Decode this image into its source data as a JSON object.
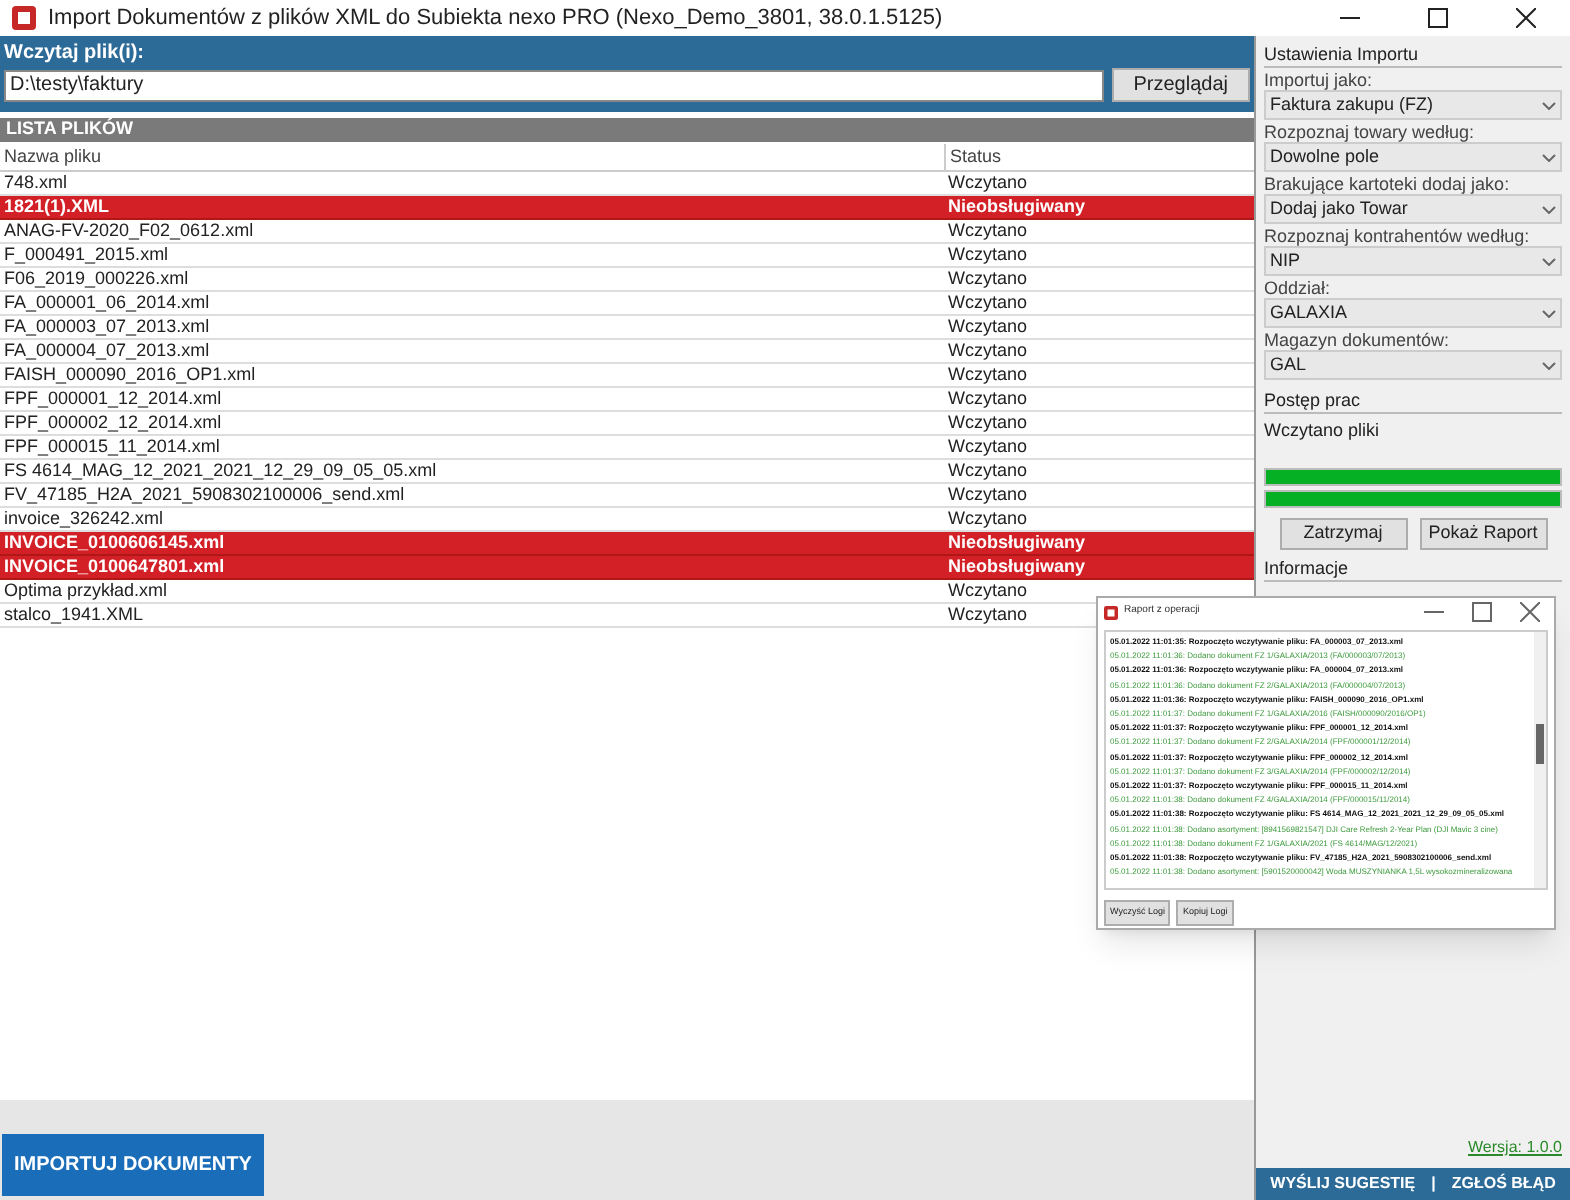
{
  "window": {
    "title": "Import Dokumentów z plików XML do Subiekta nexo PRO (Nexo_Demo_3801, 38.0.1.5125)"
  },
  "load": {
    "label": "Wczytaj plik(i):",
    "value": "D:\\testy\\faktury",
    "browse": "Przeglądaj"
  },
  "file_list": {
    "title": "LISTA PLIKÓW",
    "columns": [
      "Nazwa pliku",
      "Status"
    ],
    "rows": [
      {
        "name": "748.xml",
        "status": "Wczytano",
        "unsupported": false
      },
      {
        "name": "1821(1).XML",
        "status": "Nieobsługiwany",
        "unsupported": true
      },
      {
        "name": "ANAG-FV-2020_F02_0612.xml",
        "status": "Wczytano",
        "unsupported": false
      },
      {
        "name": "F_000491_2015.xml",
        "status": "Wczytano",
        "unsupported": false
      },
      {
        "name": "F06_2019_000226.xml",
        "status": "Wczytano",
        "unsupported": false
      },
      {
        "name": "FA_000001_06_2014.xml",
        "status": "Wczytano",
        "unsupported": false
      },
      {
        "name": "FA_000003_07_2013.xml",
        "status": "Wczytano",
        "unsupported": false
      },
      {
        "name": "FA_000004_07_2013.xml",
        "status": "Wczytano",
        "unsupported": false
      },
      {
        "name": "FAISH_000090_2016_OP1.xml",
        "status": "Wczytano",
        "unsupported": false
      },
      {
        "name": "FPF_000001_12_2014.xml",
        "status": "Wczytano",
        "unsupported": false
      },
      {
        "name": "FPF_000002_12_2014.xml",
        "status": "Wczytano",
        "unsupported": false
      },
      {
        "name": "FPF_000015_11_2014.xml",
        "status": "Wczytano",
        "unsupported": false
      },
      {
        "name": "FS 4614_MAG_12_2021_2021_12_29_09_05_05.xml",
        "status": "Wczytano",
        "unsupported": false
      },
      {
        "name": "FV_47185_H2A_2021_5908302100006_send.xml",
        "status": "Wczytano",
        "unsupported": false
      },
      {
        "name": "invoice_326242.xml",
        "status": "Wczytano",
        "unsupported": false
      },
      {
        "name": "INVOICE_0100606145.xml",
        "status": "Nieobsługiwany",
        "unsupported": true
      },
      {
        "name": "INVOICE_0100647801.xml",
        "status": "Nieobsługiwany",
        "unsupported": true
      },
      {
        "name": "Optima przykład.xml",
        "status": "Wczytano",
        "unsupported": false
      },
      {
        "name": "stalco_1941.XML",
        "status": "Wczytano",
        "unsupported": false
      }
    ]
  },
  "import_button": "IMPORTUJ DOKUMENTY",
  "settings": {
    "title": "Ustawienia Importu",
    "fields": [
      {
        "label": "Importuj jako:",
        "value": "Faktura zakupu (FZ)"
      },
      {
        "label": "Rozpoznaj towary według:",
        "value": "Dowolne pole"
      },
      {
        "label": "Brakujące kartoteki dodaj jako:",
        "value": "Dodaj jako Towar"
      },
      {
        "label": "Rozpoznaj kontrahentów według:",
        "value": "NIP"
      },
      {
        "label": "Oddział:",
        "value": "GALAXIA"
      },
      {
        "label": "Magazyn dokumentów:",
        "value": "GAL"
      }
    ]
  },
  "progress": {
    "title": "Postęp prac",
    "status": "Wczytano pliki",
    "bars": [
      {
        "level": 1
      },
      {
        "level": 1
      }
    ],
    "buttons": [
      "Zatrzymaj",
      "Pokaż Raport"
    ]
  },
  "info": {
    "title": "Informacje",
    "version": "Wersja: 1.0.0"
  },
  "footer": {
    "links": [
      "WYŚLIJ SUGESTIĘ",
      "|",
      "ZGŁOŚ BŁĄD"
    ]
  },
  "report": {
    "title": "Raport z operacji",
    "lines": [
      {
        "kind": "start",
        "text": "05.01.2022 11:01:35: Rozpoczęto wczytywanie pliku: FA_000003_07_2013.xml"
      },
      {
        "kind": "added",
        "text": "05.01.2022 11:01:36: Dodano dokument FZ 1/GALAXIA/2013 (FA/000003/07/2013)"
      },
      {
        "kind": "start",
        "text": "05.01.2022 11:01:36: Rozpoczęto wczytywanie pliku: FA_000004_07_2013.xml"
      },
      {
        "kind": "added",
        "text": "05.01.2022 11:01:36: Dodano dokument FZ 2/GALAXIA/2013 (FA/000004/07/2013)"
      },
      {
        "kind": "start",
        "text": "05.01.2022 11:01:36: Rozpoczęto wczytywanie pliku: FAISH_000090_2016_OP1.xml"
      },
      {
        "kind": "added",
        "text": "05.01.2022 11:01:37: Dodano dokument FZ 1/GALAXIA/2016 (FAISH/000090/2016/OP1)"
      },
      {
        "kind": "start",
        "text": "05.01.2022 11:01:37: Rozpoczęto wczytywanie pliku: FPF_000001_12_2014.xml"
      },
      {
        "kind": "added",
        "text": "05.01.2022 11:01:37: Dodano dokument FZ 2/GALAXIA/2014 (FPF/000001/12/2014)"
      },
      {
        "kind": "start",
        "text": "05.01.2022 11:01:37: Rozpoczęto wczytywanie pliku: FPF_000002_12_2014.xml"
      },
      {
        "kind": "added",
        "text": "05.01.2022 11:01:37: Dodano dokument FZ 3/GALAXIA/2014 (FPF/000002/12/2014)"
      },
      {
        "kind": "start",
        "text": "05.01.2022 11:01:37: Rozpoczęto wczytywanie pliku: FPF_000015_11_2014.xml"
      },
      {
        "kind": "added",
        "text": "05.01.2022 11:01:38: Dodano dokument FZ 4/GALAXIA/2014 (FPF/000015/11/2014)"
      },
      {
        "kind": "start",
        "text": "05.01.2022 11:01:38: Rozpoczęto wczytywanie pliku: FS 4614_MAG_12_2021_2021_12_29_09_05_05.xml"
      },
      {
        "kind": "added",
        "text": "05.01.2022 11:01:38: Dodano asortyment: [8941569821547] DJI Care Refresh 2-Year Plan (DJI Mavic 3 cine)"
      },
      {
        "kind": "added",
        "text": "05.01.2022 11:01:38: Dodano dokument FZ 1/GALAXIA/2021 (FS 4614/MAG/12/2021)"
      },
      {
        "kind": "start",
        "text": "05.01.2022 11:01:38: Rozpoczęto wczytywanie pliku: FV_47185_H2A_2021_5908302100006_send.xml"
      },
      {
        "kind": "added",
        "text": "05.01.2022 11:01:38: Dodano asortyment: [5901520000042] Woda MUSZYNIANKA 1,5L wysokozmineralizowana"
      }
    ],
    "buttons": [
      "Wyczyść Logi",
      "Kopiuj Logi"
    ]
  }
}
